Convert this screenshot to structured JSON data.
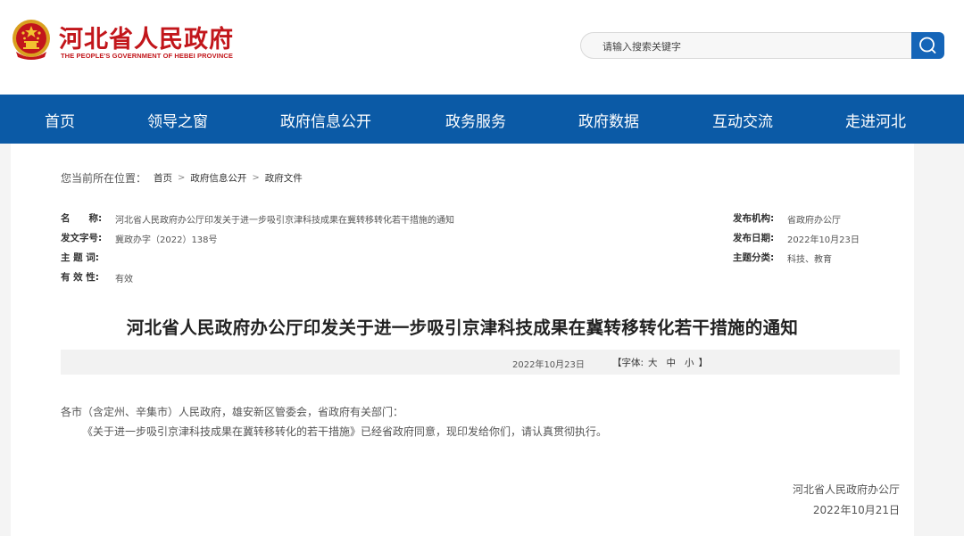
{
  "header": {
    "title": "河北省人民政府",
    "subtitle": "THE PEOPLE'S GOVERNMENT OF HEBEI PROVINCE",
    "emblem_icon": "national-emblem-icon"
  },
  "search": {
    "placeholder": "请输入搜索关键字",
    "button_icon": "search-icon"
  },
  "nav": {
    "items": [
      {
        "label": "首页"
      },
      {
        "label": "领导之窗"
      },
      {
        "label": "政府信息公开"
      },
      {
        "label": "政务服务"
      },
      {
        "label": "政府数据"
      },
      {
        "label": "互动交流"
      },
      {
        "label": "走进河北"
      }
    ]
  },
  "breadcrumb": {
    "prefix": "您当前所在位置：",
    "items": [
      {
        "label": "首页"
      },
      {
        "label": "政府信息公开"
      },
      {
        "label": "政府文件"
      }
    ]
  },
  "meta": {
    "name_label": "名　　称:",
    "name_value": "河北省人民政府办公厅印发关于进一步吸引京津科技成果在冀转移转化若干措施的通知",
    "doc_no_label": "发文字号:",
    "doc_no_value": "冀政办字（2022）138号",
    "subject_label": "主 题 词:",
    "subject_value": "",
    "validity_label": "有 效 性:",
    "validity_value": "有效",
    "publisher_label": "发布机构:",
    "publisher_value": "省政府办公厅",
    "publish_date_label": "发布日期:",
    "publish_date_value": "2022年10月23日",
    "category_label": "主题分类:",
    "category_value": "科技、教育"
  },
  "article": {
    "title": "河北省人民政府办公厅印发关于进一步吸引京津科技成果在冀转移转化若干措施的通知",
    "date": "2022年10月23日",
    "font_prefix": "【字体:",
    "font_sizes": [
      "大",
      "中",
      "小"
    ],
    "font_suffix": "】",
    "salutation": "各市（含定州、辛集市）人民政府，雄安新区管委会，省政府有关部门：",
    "paragraph1": "《关于进一步吸引京津科技成果在冀转移转化的若干措施》已经省政府同意，现印发给你们，请认真贯彻执行。",
    "signature": "河北省人民政府办公厅",
    "sign_date": "2022年10月21日"
  },
  "colors": {
    "brand_red": "#c2161b",
    "nav_blue": "#0b5aa6",
    "search_blue": "#1565b8"
  }
}
